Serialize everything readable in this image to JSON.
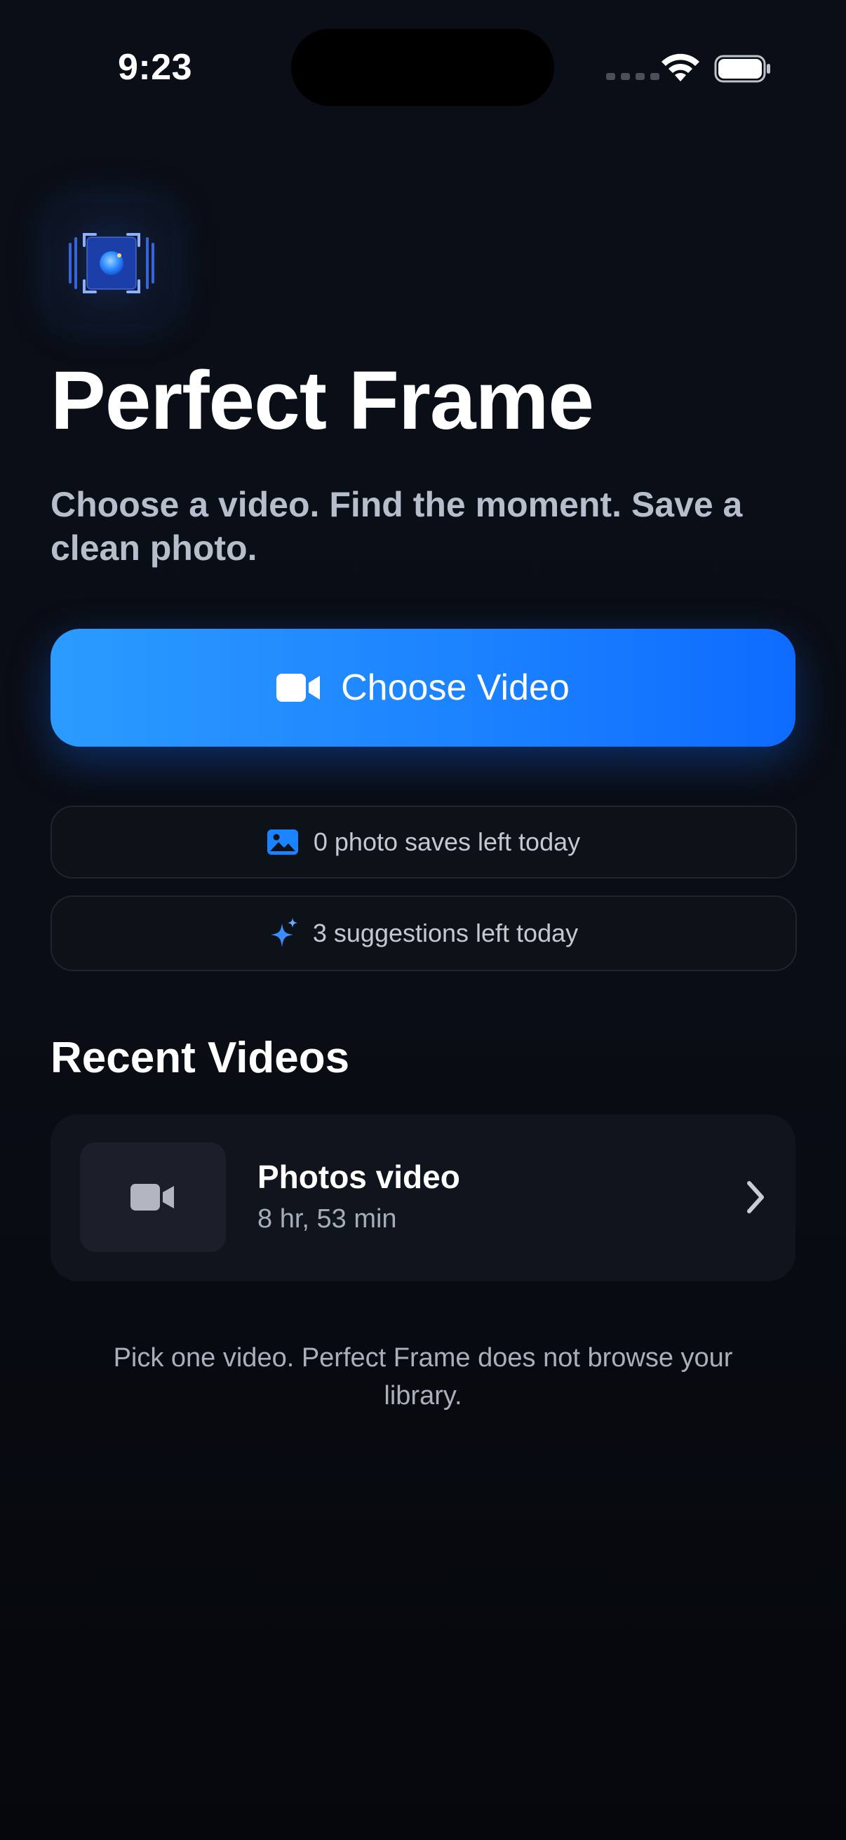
{
  "status_bar": {
    "time": "9:23",
    "icons": [
      "cellular-signal-icon",
      "wifi-icon",
      "battery-icon"
    ]
  },
  "app": {
    "icon": "perfect-frame-app-icon",
    "title": "Perfect Frame",
    "subtitle": "Choose a video. Find the moment. Save a clean photo."
  },
  "primary_action": {
    "label": "Choose Video",
    "icon": "video-camera-icon",
    "color_start": "#2b9bff",
    "color_end": "#0e6bff"
  },
  "quotas": [
    {
      "icon": "photo-icon",
      "label": "0 photo saves left today"
    },
    {
      "icon": "sparkles-icon",
      "label": "3 suggestions left today"
    }
  ],
  "recent": {
    "heading": "Recent Videos",
    "items": [
      {
        "thumbnail_icon": "video-camera-icon",
        "title": "Photos video",
        "duration": "8 hr, 53 min"
      }
    ]
  },
  "footer_note": "Pick one video. Perfect Frame does not browse your library.",
  "colors": {
    "background": "#0a0e16",
    "accent": "#1c83ff",
    "card": "#10141c"
  }
}
